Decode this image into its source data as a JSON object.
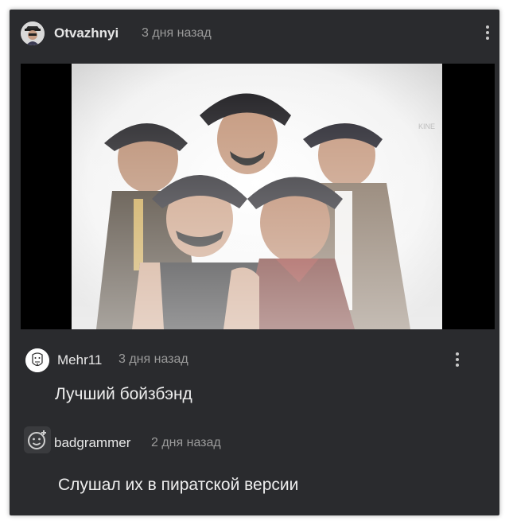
{
  "post": {
    "author": "Otvazhnyi",
    "time": "3 дня назад",
    "avatar_icon": "pirate-avatar-icon",
    "menu_icon": "more-vertical-icon"
  },
  "media": {
    "watermark": "KINE"
  },
  "comments": [
    {
      "author": "Mehr11",
      "time": "3 дня назад",
      "text": "Лучший бойзбэнд",
      "avatar_icon": "face-avatar-icon",
      "menu_icon": "more-vertical-icon"
    },
    {
      "author": "badgrammer",
      "time": "2 дня назад",
      "text": "Слушал их в пиратской версии",
      "avatar_icon": "smiley-plus-icon"
    }
  ],
  "colors": {
    "background": "#2a2b2e",
    "text_primary": "#e6e6e6",
    "text_secondary": "#9b9b9b"
  }
}
